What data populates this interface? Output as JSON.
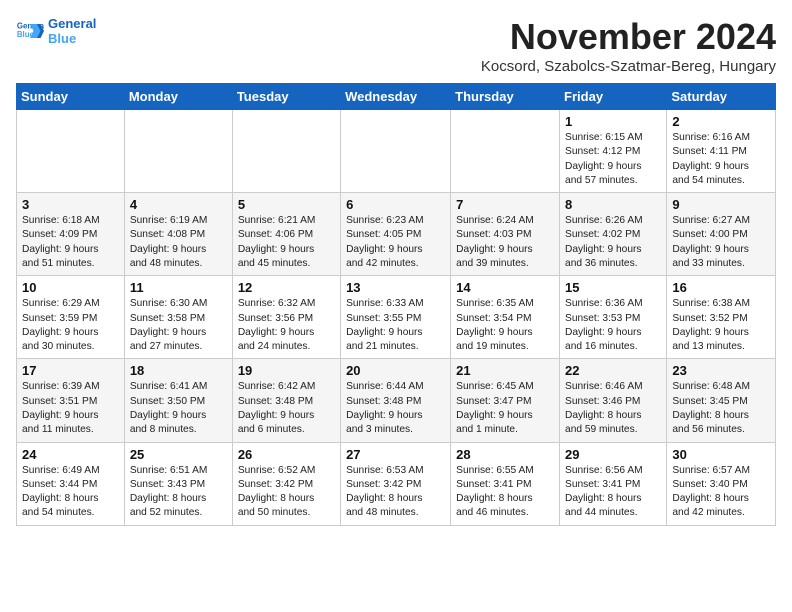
{
  "header": {
    "logo_line1": "General",
    "logo_line2": "Blue",
    "month_title": "November 2024",
    "subtitle": "Kocsord, Szabolcs-Szatmar-Bereg, Hungary"
  },
  "weekdays": [
    "Sunday",
    "Monday",
    "Tuesday",
    "Wednesday",
    "Thursday",
    "Friday",
    "Saturday"
  ],
  "weeks": [
    [
      {
        "day": "",
        "info": ""
      },
      {
        "day": "",
        "info": ""
      },
      {
        "day": "",
        "info": ""
      },
      {
        "day": "",
        "info": ""
      },
      {
        "day": "",
        "info": ""
      },
      {
        "day": "1",
        "info": "Sunrise: 6:15 AM\nSunset: 4:12 PM\nDaylight: 9 hours\nand 57 minutes."
      },
      {
        "day": "2",
        "info": "Sunrise: 6:16 AM\nSunset: 4:11 PM\nDaylight: 9 hours\nand 54 minutes."
      }
    ],
    [
      {
        "day": "3",
        "info": "Sunrise: 6:18 AM\nSunset: 4:09 PM\nDaylight: 9 hours\nand 51 minutes."
      },
      {
        "day": "4",
        "info": "Sunrise: 6:19 AM\nSunset: 4:08 PM\nDaylight: 9 hours\nand 48 minutes."
      },
      {
        "day": "5",
        "info": "Sunrise: 6:21 AM\nSunset: 4:06 PM\nDaylight: 9 hours\nand 45 minutes."
      },
      {
        "day": "6",
        "info": "Sunrise: 6:23 AM\nSunset: 4:05 PM\nDaylight: 9 hours\nand 42 minutes."
      },
      {
        "day": "7",
        "info": "Sunrise: 6:24 AM\nSunset: 4:03 PM\nDaylight: 9 hours\nand 39 minutes."
      },
      {
        "day": "8",
        "info": "Sunrise: 6:26 AM\nSunset: 4:02 PM\nDaylight: 9 hours\nand 36 minutes."
      },
      {
        "day": "9",
        "info": "Sunrise: 6:27 AM\nSunset: 4:00 PM\nDaylight: 9 hours\nand 33 minutes."
      }
    ],
    [
      {
        "day": "10",
        "info": "Sunrise: 6:29 AM\nSunset: 3:59 PM\nDaylight: 9 hours\nand 30 minutes."
      },
      {
        "day": "11",
        "info": "Sunrise: 6:30 AM\nSunset: 3:58 PM\nDaylight: 9 hours\nand 27 minutes."
      },
      {
        "day": "12",
        "info": "Sunrise: 6:32 AM\nSunset: 3:56 PM\nDaylight: 9 hours\nand 24 minutes."
      },
      {
        "day": "13",
        "info": "Sunrise: 6:33 AM\nSunset: 3:55 PM\nDaylight: 9 hours\nand 21 minutes."
      },
      {
        "day": "14",
        "info": "Sunrise: 6:35 AM\nSunset: 3:54 PM\nDaylight: 9 hours\nand 19 minutes."
      },
      {
        "day": "15",
        "info": "Sunrise: 6:36 AM\nSunset: 3:53 PM\nDaylight: 9 hours\nand 16 minutes."
      },
      {
        "day": "16",
        "info": "Sunrise: 6:38 AM\nSunset: 3:52 PM\nDaylight: 9 hours\nand 13 minutes."
      }
    ],
    [
      {
        "day": "17",
        "info": "Sunrise: 6:39 AM\nSunset: 3:51 PM\nDaylight: 9 hours\nand 11 minutes."
      },
      {
        "day": "18",
        "info": "Sunrise: 6:41 AM\nSunset: 3:50 PM\nDaylight: 9 hours\nand 8 minutes."
      },
      {
        "day": "19",
        "info": "Sunrise: 6:42 AM\nSunset: 3:48 PM\nDaylight: 9 hours\nand 6 minutes."
      },
      {
        "day": "20",
        "info": "Sunrise: 6:44 AM\nSunset: 3:48 PM\nDaylight: 9 hours\nand 3 minutes."
      },
      {
        "day": "21",
        "info": "Sunrise: 6:45 AM\nSunset: 3:47 PM\nDaylight: 9 hours\nand 1 minute."
      },
      {
        "day": "22",
        "info": "Sunrise: 6:46 AM\nSunset: 3:46 PM\nDaylight: 8 hours\nand 59 minutes."
      },
      {
        "day": "23",
        "info": "Sunrise: 6:48 AM\nSunset: 3:45 PM\nDaylight: 8 hours\nand 56 minutes."
      }
    ],
    [
      {
        "day": "24",
        "info": "Sunrise: 6:49 AM\nSunset: 3:44 PM\nDaylight: 8 hours\nand 54 minutes."
      },
      {
        "day": "25",
        "info": "Sunrise: 6:51 AM\nSunset: 3:43 PM\nDaylight: 8 hours\nand 52 minutes."
      },
      {
        "day": "26",
        "info": "Sunrise: 6:52 AM\nSunset: 3:42 PM\nDaylight: 8 hours\nand 50 minutes."
      },
      {
        "day": "27",
        "info": "Sunrise: 6:53 AM\nSunset: 3:42 PM\nDaylight: 8 hours\nand 48 minutes."
      },
      {
        "day": "28",
        "info": "Sunrise: 6:55 AM\nSunset: 3:41 PM\nDaylight: 8 hours\nand 46 minutes."
      },
      {
        "day": "29",
        "info": "Sunrise: 6:56 AM\nSunset: 3:41 PM\nDaylight: 8 hours\nand 44 minutes."
      },
      {
        "day": "30",
        "info": "Sunrise: 6:57 AM\nSunset: 3:40 PM\nDaylight: 8 hours\nand 42 minutes."
      }
    ]
  ]
}
